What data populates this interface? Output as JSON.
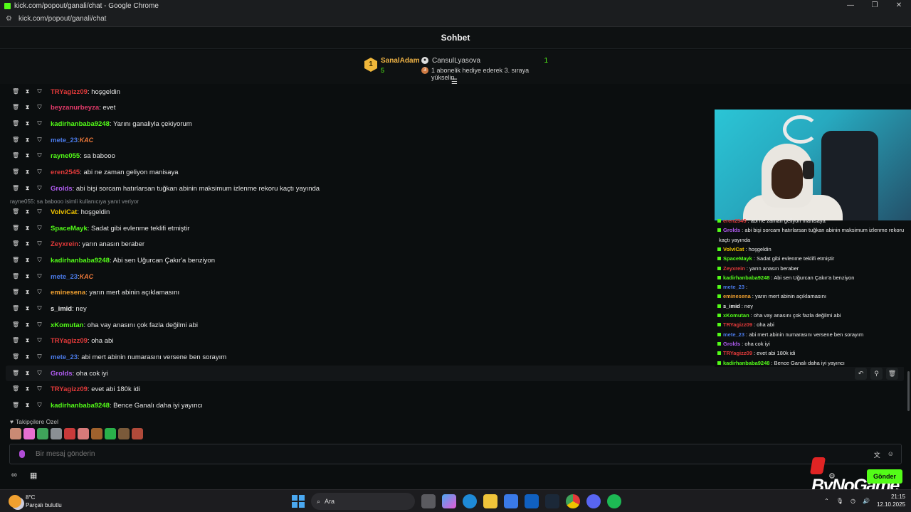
{
  "window": {
    "title": "kick.com/popout/ganali/chat - Google Chrome",
    "url": "kick.com/popout/ganali/chat",
    "controls": [
      "—",
      "❐",
      "✕"
    ]
  },
  "chat_header": {
    "title": "Sohbet"
  },
  "pinned_gift": {
    "rank_number": "1",
    "top_user": "SanalAdam",
    "top_user_count": "5",
    "gifter": "CansulLyasova",
    "gifter_count": "1",
    "rank_badge": "3",
    "description": "1 abonelik hediye ederek 3. sıraya yükselin"
  },
  "messages": [
    {
      "user": "TRYagizz09",
      "color": "#e33a3a",
      "text": ": hoşgeldin"
    },
    {
      "user": "beyzanurbeyza",
      "color": "#e33a6a",
      "text": ": evet"
    },
    {
      "user": "kadirhanbaba9248",
      "color": "#53fc18",
      "text": ": Yarını ganaliyla çekiyorum"
    },
    {
      "user": "mete_23",
      "color": "#4a7ae8",
      "text": ": ",
      "emote": "KAC"
    },
    {
      "user": "rayne055",
      "color": "#53fc18",
      "text": ": sa babooo"
    },
    {
      "user": "eren2545",
      "color": "#e33a3a",
      "text": ": abi ne zaman geliyon manisaya"
    },
    {
      "user": "Grolds",
      "color": "#b05cf0",
      "text": ": abi bişi sorcam hatırlarsan tuğkan abinin maksimum izlenme rekoru kaçtı yayında"
    },
    {
      "user": "VolviCat",
      "color": "#f0c400",
      "text": ": hoşgeldin"
    },
    {
      "user": "SpaceMayk",
      "color": "#53fc18",
      "text": ": Sadat gibi evlenme teklifi etmiştir"
    },
    {
      "user": "Zeyxrein",
      "color": "#e33a3a",
      "text": ": yarın anasın beraber"
    },
    {
      "user": "kadirhanbaba9248",
      "color": "#53fc18",
      "text": ": Abi sen Uğurcan Çakır'a benziyon"
    },
    {
      "user": "mete_23",
      "color": "#4a7ae8",
      "text": ": ",
      "emote": "KAC"
    },
    {
      "user": "eminesena",
      "color": "#f0a030",
      "text": ": yarın mert abinin açıklamasını"
    },
    {
      "user": "s_imid",
      "color": "#e6e6e6",
      "text": ": ney"
    },
    {
      "user": "xKomutan",
      "color": "#53fc18",
      "text": ": oha vay anasını çok fazla değilmi abi"
    },
    {
      "user": "TRYagizz09",
      "color": "#e33a3a",
      "text": ": oha abi"
    },
    {
      "user": "mete_23",
      "color": "#4a7ae8",
      "text": ": abi mert abinin numarasını versene ben sorayım"
    },
    {
      "user": "Grolds",
      "color": "#b05cf0",
      "text": ": oha cok iyi"
    },
    {
      "user": "TRYagizz09",
      "color": "#e33a3a",
      "text": ": evet abi 180k idi"
    },
    {
      "user": "kadirhanbaba9248",
      "color": "#53fc18",
      "text": ": Bence Ganalı daha iyi yayıncı"
    }
  ],
  "reply_note": "rayne055: sa babooo isimli kullanıcıya yanıt veriyor",
  "overlay_chat": [
    {
      "user": "eren2545",
      "color": "#e33a3a",
      "text": ": abi ne zaman geliyon manisaya"
    },
    {
      "user": "Grolds",
      "color": "#b05cf0",
      "text": ": abi bişi sorcam hatırlarsan tuğkan abinin maksimum izlenme rekoru"
    },
    {
      "user": "",
      "color": "#eee",
      "text": "kaçtı yayında"
    },
    {
      "user": "VolviCat",
      "color": "#f0c400",
      "text": ": hoşgeldin"
    },
    {
      "user": "SpaceMayk",
      "color": "#53fc18",
      "text": ": Sadat gibi evlenme teklifi etmiştir"
    },
    {
      "user": "Zeyxrein",
      "color": "#e33a3a",
      "text": ": yarın anasın beraber"
    },
    {
      "user": "kadirhanbaba9248",
      "color": "#53fc18",
      "text": ": Abi sen Uğurcan Çakır'a benziyon"
    },
    {
      "user": "mete_23",
      "color": "#4a7ae8",
      "text": ": "
    },
    {
      "user": "eminesena",
      "color": "#f0a030",
      "text": ": yarın mert abinin açıklamasını"
    },
    {
      "user": "s_imid",
      "color": "#eee",
      "text": ": ney"
    },
    {
      "user": "xKomutan",
      "color": "#53fc18",
      "text": ": oha vay anasını çok fazla değilmi abi"
    },
    {
      "user": "TRYagizz09",
      "color": "#e33a3a",
      "text": ": oha abi"
    },
    {
      "user": "mete_23",
      "color": "#4a7ae8",
      "text": ": abi mert abinin numarasını versene ben sorayım"
    },
    {
      "user": "Grolds",
      "color": "#b05cf0",
      "text": ": oha cok iyi"
    },
    {
      "user": "TRYagizz09",
      "color": "#e33a3a",
      "text": ": evet abi 180k idi"
    },
    {
      "user": "kadirhanbaba9248",
      "color": "#53fc18",
      "text": ": Bence Ganalı daha iyi yayıncı"
    }
  ],
  "followers_label": "Takipçilere Özel",
  "input": {
    "placeholder": "Bir mesaj gönderin"
  },
  "send_label": "Gönder",
  "brand": "ByNoGame",
  "taskbar": {
    "temp": "8°C",
    "weather": "Parçalı bulutlu",
    "search": "Ara",
    "time": "21:15",
    "date": "12.10.2025"
  }
}
